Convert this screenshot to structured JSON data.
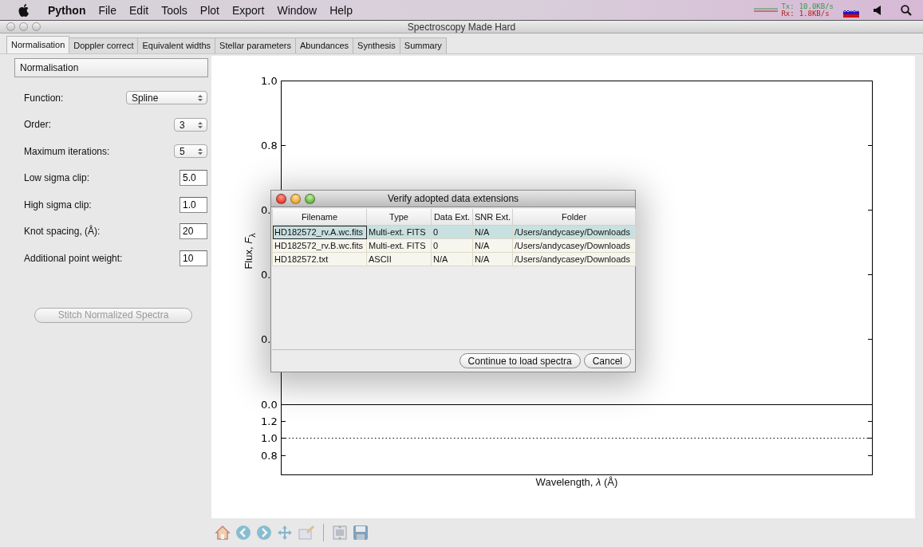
{
  "menubar": {
    "items": [
      {
        "label": "Python",
        "kind": "app"
      },
      {
        "label": "File",
        "kind": "menu"
      },
      {
        "label": "Edit",
        "kind": "menu"
      },
      {
        "label": "Tools",
        "kind": "menu"
      },
      {
        "label": "Plot",
        "kind": "menu"
      },
      {
        "label": "Export",
        "kind": "menu"
      },
      {
        "label": "Window",
        "kind": "menu"
      },
      {
        "label": "Help",
        "kind": "menu"
      }
    ],
    "network": {
      "tx_label": "Tx:",
      "tx_rate": "10.0KB/s",
      "rx_label": "Rx:",
      "rx_rate": "1.8KB/s"
    }
  },
  "window": {
    "title": "Spectroscopy Made Hard"
  },
  "tabs": [
    {
      "label": "Normalisation",
      "selected": true
    },
    {
      "label": "Doppler correct",
      "selected": false
    },
    {
      "label": "Equivalent widths",
      "selected": false
    },
    {
      "label": "Stellar parameters",
      "selected": false
    },
    {
      "label": "Abundances",
      "selected": false
    },
    {
      "label": "Synthesis",
      "selected": false
    },
    {
      "label": "Summary",
      "selected": false
    }
  ],
  "panel": {
    "title": "Normalisation",
    "rows": [
      {
        "kind": "select",
        "label": "Function:",
        "value": "Spline"
      },
      {
        "kind": "spinner",
        "label": "Order:",
        "value": "3"
      },
      {
        "kind": "spinner",
        "label": "Maximum iterations:",
        "value": "5"
      },
      {
        "kind": "field",
        "label": "Low sigma clip:",
        "value": "5.0"
      },
      {
        "kind": "field",
        "label": "High sigma clip:",
        "value": "1.0"
      },
      {
        "kind": "field",
        "label": "Knot spacing, (Å):",
        "value": "20"
      },
      {
        "kind": "field",
        "label": "Additional point weight:",
        "value": "10"
      }
    ],
    "button": {
      "label": "Stitch Normalized Spectra",
      "disabled": true
    }
  },
  "plot": {
    "top_yticks": [
      "1.0",
      "0.8",
      "0.",
      "0.",
      "0.",
      "0.0"
    ],
    "bottom_yticks": [
      "1.2",
      "1.0",
      "0.8"
    ],
    "ylabel": "Flux, *F*$_{λ}$",
    "xlabel": "Wavelength, *λ* (Å)"
  },
  "dialog": {
    "title": "Verify adopted data extensions",
    "columns": [
      "Filename",
      "Type",
      "Data Ext.",
      "SNR Ext.",
      "Folder"
    ],
    "rows": [
      {
        "cells": [
          "HD182572_rv.A.wc.fits",
          "Multi-ext. FITS",
          "0",
          "N/A",
          "/Users/andycasey/Downloads"
        ],
        "selected": true
      },
      {
        "cells": [
          "HD182572_rv.B.wc.fits",
          "Multi-ext. FITS",
          "0",
          "N/A",
          "/Users/andycasey/Downloads"
        ],
        "selected": false
      },
      {
        "cells": [
          "HD182572.txt",
          "ASCII",
          "N/A",
          "N/A",
          "/Users/andycasey/Downloads"
        ],
        "selected": false
      }
    ],
    "buttons": [
      "Continue to load spectra",
      "Cancel"
    ]
  }
}
